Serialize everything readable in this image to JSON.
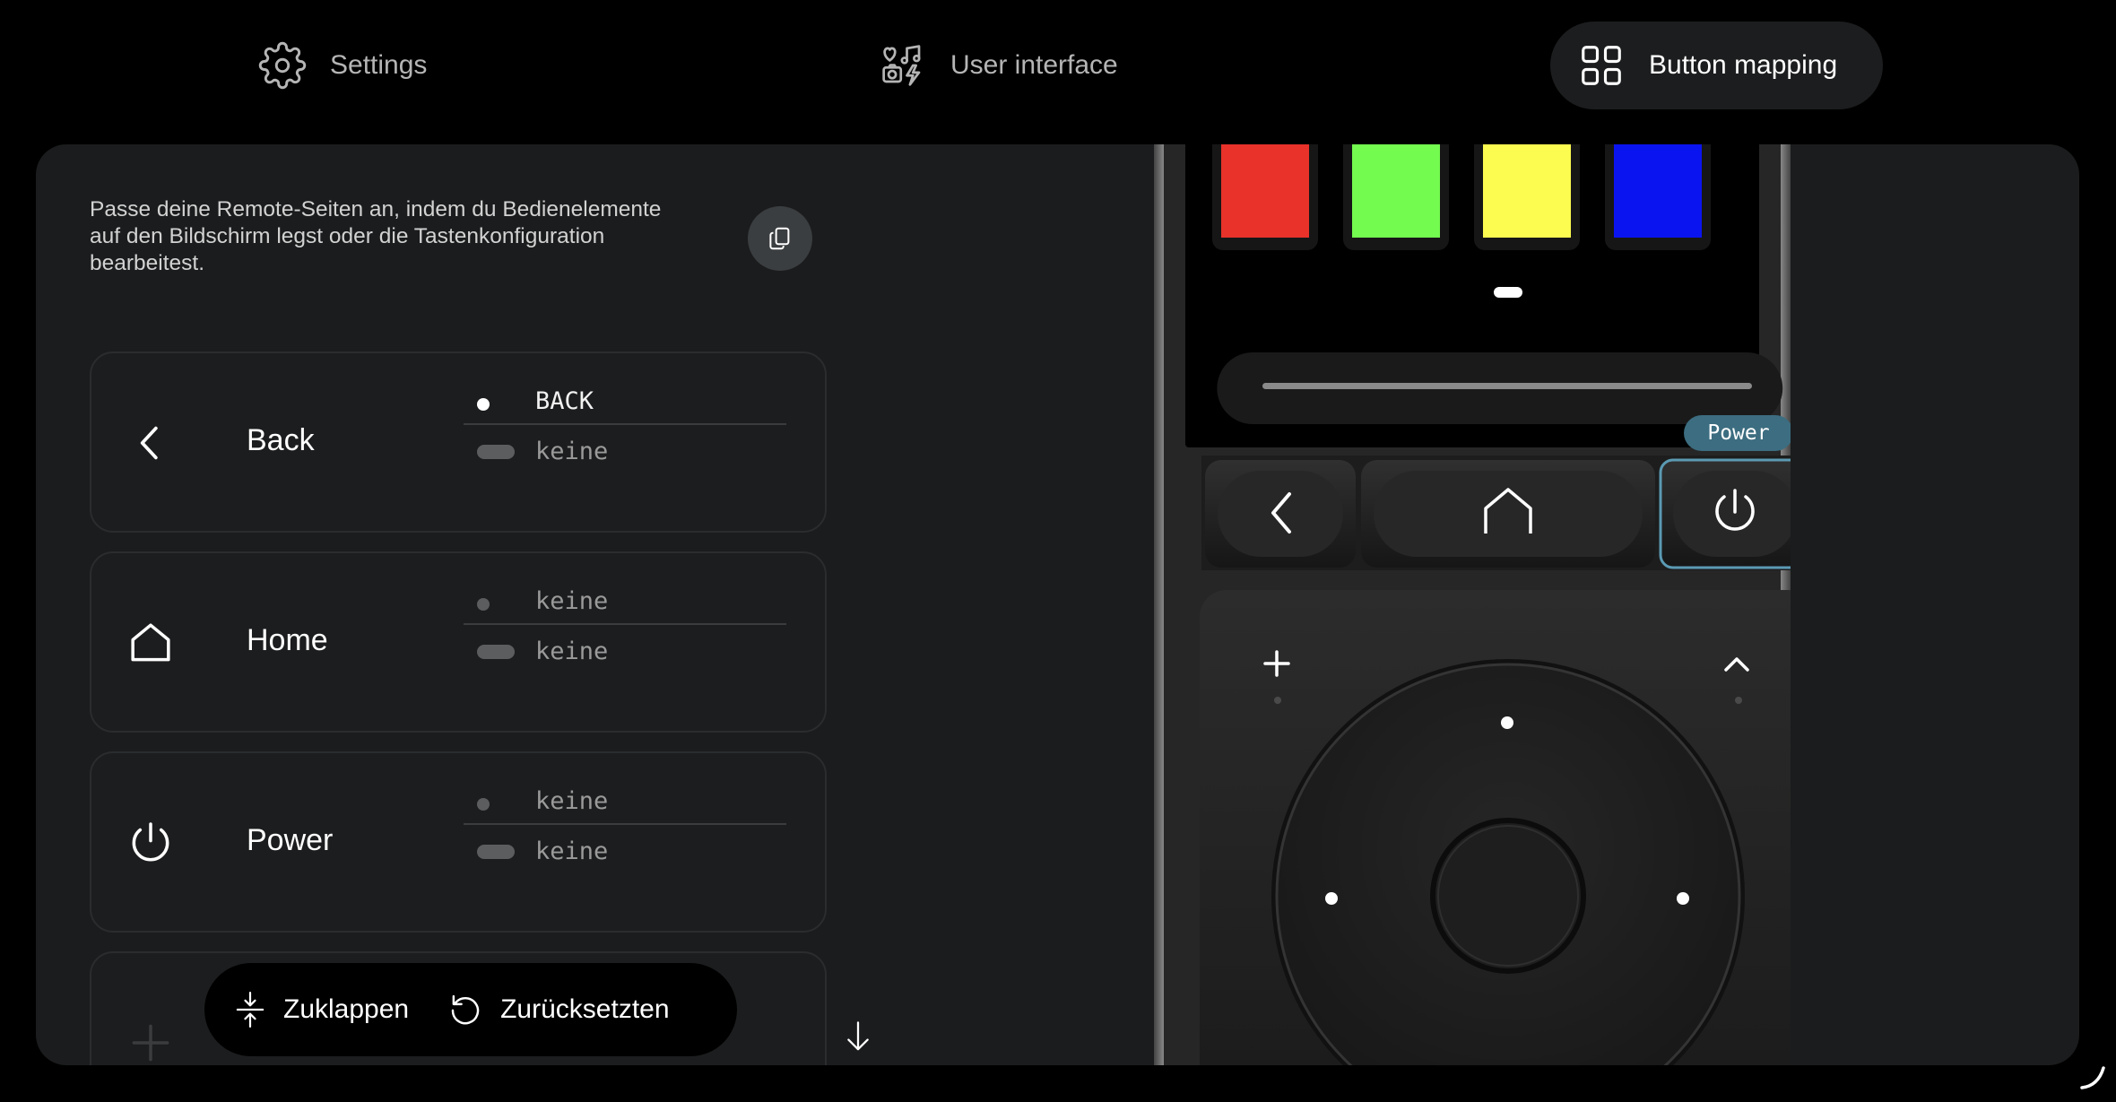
{
  "nav": {
    "settings_label": "Settings",
    "ui_label": "User interface",
    "mapping_label": "Button mapping",
    "active": "Button mapping"
  },
  "intro": {
    "text": "Passe deine Remote-Seiten an, indem du Bedienelemente auf den Bildschirm legst oder die Tastenkonfiguration bearbeitest."
  },
  "buttons": [
    {
      "name": "Back",
      "icon": "chevron-left-icon",
      "short_press": "BACK",
      "long_press": "keine"
    },
    {
      "name": "Home",
      "icon": "home-icon",
      "short_press": "keine",
      "long_press": "keine"
    },
    {
      "name": "Power",
      "icon": "power-icon",
      "short_press": "keine",
      "long_press": "keine"
    }
  ],
  "toolbar": {
    "collapse_label": "Zuklappen",
    "reset_label": "Zurücksetzten"
  },
  "remote": {
    "tooltip": "Power",
    "color_buttons": [
      "#e8322a",
      "#73fb4f",
      "#fbfb50",
      "#0a14f0"
    ],
    "highlight_color": "#5b9ab3"
  }
}
